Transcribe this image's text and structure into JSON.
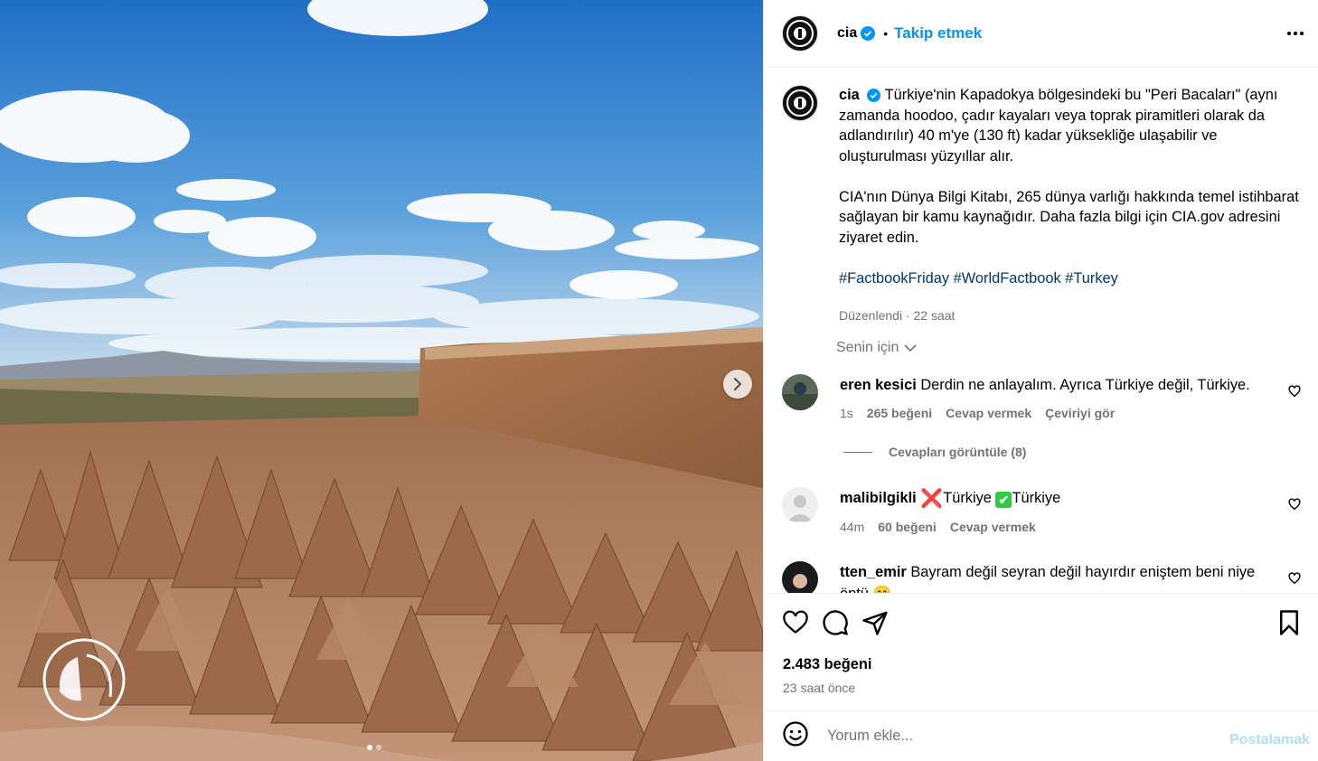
{
  "colors": {
    "accent": "#0095f6",
    "muted": "#737373",
    "hashtag": "#00376b"
  },
  "header": {
    "username": "cia",
    "separator": "•",
    "follow_label": "Takip etmek",
    "verified_icon": "verified-badge-icon",
    "more_icon": "more-options-icon"
  },
  "media": {
    "next_icon": "chevron-right-icon",
    "slide_count": 2,
    "active_slide": 1
  },
  "caption": {
    "username": "cia",
    "paragraph1": "Türkiye'nin Kapadokya bölgesindeki bu \"Peri Bacaları\" (aynı zamanda hoodoo, çadır kayaları veya toprak piramitleri olarak da adlandırılır) 40 m'ye (130 ft) kadar yüksekliğe ulaşabilir ve oluşturulması yüzyıllar alır.",
    "paragraph2": "CIA'nın Dünya Bilgi Kitabı, 265 dünya varlığı hakkında temel istihbarat sağlayan bir kamu kaynağıdır. Daha fazla bilgi için CIA.gov adresini ziyaret edin.",
    "hashtags": "#FactbookFriday #WorldFactbook #Turkey",
    "edited": "Düzenlendi",
    "meta_sep": " · ",
    "time": "22 saat"
  },
  "sort": {
    "label": "Senin için"
  },
  "comments": [
    {
      "username": "eren kesici",
      "text": "Derdin ne anlayalım. Ayrıca Türkiye değil, Türkiye.",
      "time": "1s",
      "likes": "265 beğeni",
      "reply": "Cevap vermek",
      "translate": "Çeviriyi gör",
      "replies": "Cevapları görüntüle (8)"
    },
    {
      "username": "malibilgikli",
      "text_a": "Türkiye",
      "text_b": "Türkiye",
      "x_mark": "❌",
      "check_mark": "✔",
      "time": "44m",
      "likes": "60 beğeni",
      "reply": "Cevap vermek"
    },
    {
      "username": "tten_emir",
      "text": "Bayram değil seyran değil hayırdır eniştem beni niye öptü 😁"
    }
  ],
  "actions": {
    "likes": "2.483 beğeni",
    "ago": "23 saat önce"
  },
  "composer": {
    "placeholder": "Yorum ekle...",
    "post_label": "Postalamak",
    "emoji_icon": "emoji-icon"
  }
}
